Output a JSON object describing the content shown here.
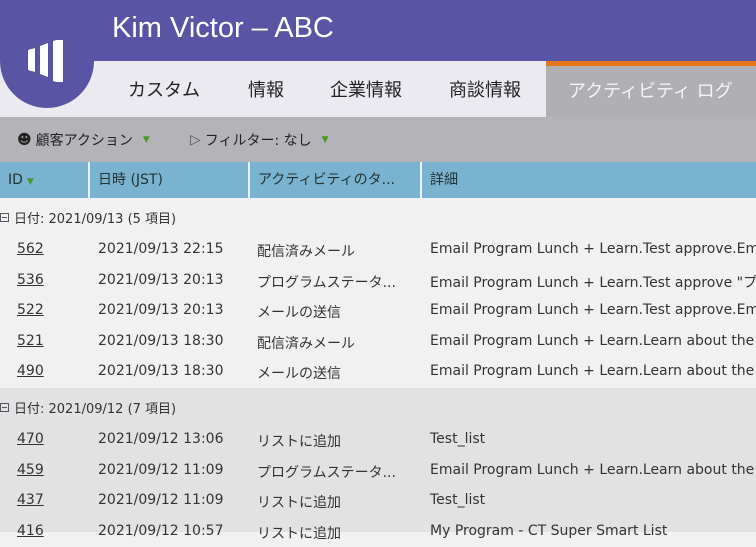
{
  "header": {
    "title": "Kim Victor – ABC"
  },
  "tabs": [
    {
      "label": "カスタム"
    },
    {
      "label": "情報"
    },
    {
      "label": "企業情報"
    },
    {
      "label": "商談情報"
    },
    {
      "label": "アクティビティ ログ",
      "active": true
    }
  ],
  "toolbar": {
    "customer_action": "顧客アクション",
    "filter": "フィルター: なし"
  },
  "columns": [
    "ID",
    "日時 (JST)",
    "アクティビティのタ...",
    "詳細"
  ],
  "groups": [
    {
      "label": "日付: 2021/09/13 (5 項目)",
      "rows": [
        [
          "562",
          "2021/09/13 22:15",
          "配信済みメール",
          "Email Program Lunch + Learn.Test approve.Ema"
        ],
        [
          "536",
          "2021/09/13 20:13",
          "プログラムステータ...",
          "Email Program Lunch + Learn.Test approve \"プロ"
        ],
        [
          "522",
          "2021/09/13 20:13",
          "メールの送信",
          "Email Program Lunch + Learn.Test approve.Ema"
        ],
        [
          "521",
          "2021/09/13 18:30",
          "配信済みメール",
          "Email Program Lunch + Learn.Learn about the s"
        ],
        [
          "490",
          "2021/09/13 18:30",
          "メールの送信",
          "Email Program Lunch + Learn.Learn about the s"
        ]
      ]
    },
    {
      "label": "日付: 2021/09/12 (7 項目)",
      "rows": [
        [
          "470",
          "2021/09/12 13:06",
          "リストに追加",
          "Test_list"
        ],
        [
          "459",
          "2021/09/12 11:09",
          "プログラムステータ...",
          "Email Program Lunch + Learn.Learn about the s"
        ],
        [
          "437",
          "2021/09/12 11:09",
          "リストに追加",
          "Test_list"
        ],
        [
          "416",
          "2021/09/12 10:57",
          "リストに追加",
          "My Program - CT Super Smart List"
        ]
      ]
    }
  ]
}
